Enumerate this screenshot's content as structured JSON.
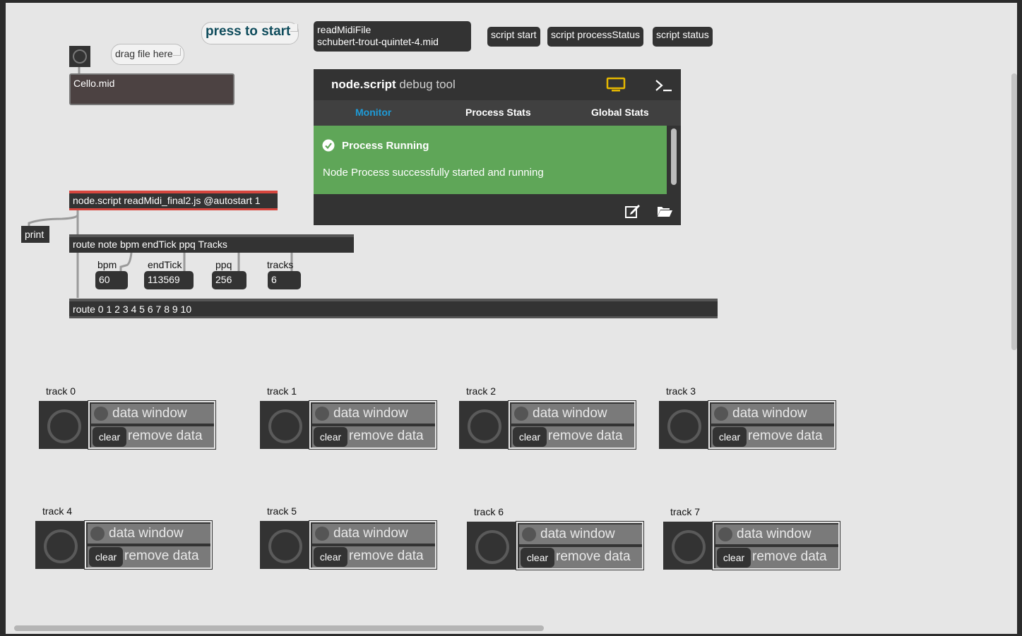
{
  "patch": {
    "press_to_start": "press to start",
    "read_msg_line1": "readMidiFile",
    "read_msg_line2": "schubert-trout-quintet-4.mid",
    "script_start": "script start",
    "script_process_status": "script processStatus",
    "script_status": "script status",
    "drag_file_hint": "drag file here",
    "dropfile_value": "Cello.mid",
    "node_script": "node.script readMidi_final2.js @autostart 1",
    "print": "print",
    "route_main": "route note bpm endTick ppq Tracks",
    "route_tracks": "route 0 1 2 3 4 5 6 7 8 9 10"
  },
  "numboxes": [
    {
      "label": "bpm",
      "value": "60"
    },
    {
      "label": "endTick",
      "value": "113569"
    },
    {
      "label": "ppq",
      "value": "256"
    },
    {
      "label": "tracks",
      "value": "6"
    }
  ],
  "debug_tool": {
    "title_bold": "node.script",
    "title_rest": "debug tool",
    "tabs": [
      "Monitor",
      "Process Stats",
      "Global Stats"
    ],
    "status_title": "Process Running",
    "status_message": "Node Process successfully started and running",
    "accent_color": "#1e9bd7",
    "status_color": "#5fa658",
    "monitor_icon_color": "#e6b800"
  },
  "tracks": [
    {
      "label": "track 0",
      "data_window": "data window",
      "clear": "clear",
      "remove": "remove data"
    },
    {
      "label": "track 1",
      "data_window": "data window",
      "clear": "clear",
      "remove": "remove data"
    },
    {
      "label": "track 2",
      "data_window": "data window",
      "clear": "clear",
      "remove": "remove data"
    },
    {
      "label": "track 3",
      "data_window": "data window",
      "clear": "clear",
      "remove": "remove data"
    },
    {
      "label": "track 4",
      "data_window": "data window",
      "clear": "clear",
      "remove": "remove data"
    },
    {
      "label": "track 5",
      "data_window": "data window",
      "clear": "clear",
      "remove": "remove data"
    },
    {
      "label": "track 6",
      "data_window": "data window",
      "clear": "clear",
      "remove": "remove data"
    },
    {
      "label": "track 7",
      "data_window": "data window",
      "clear": "clear",
      "remove": "remove data"
    }
  ]
}
